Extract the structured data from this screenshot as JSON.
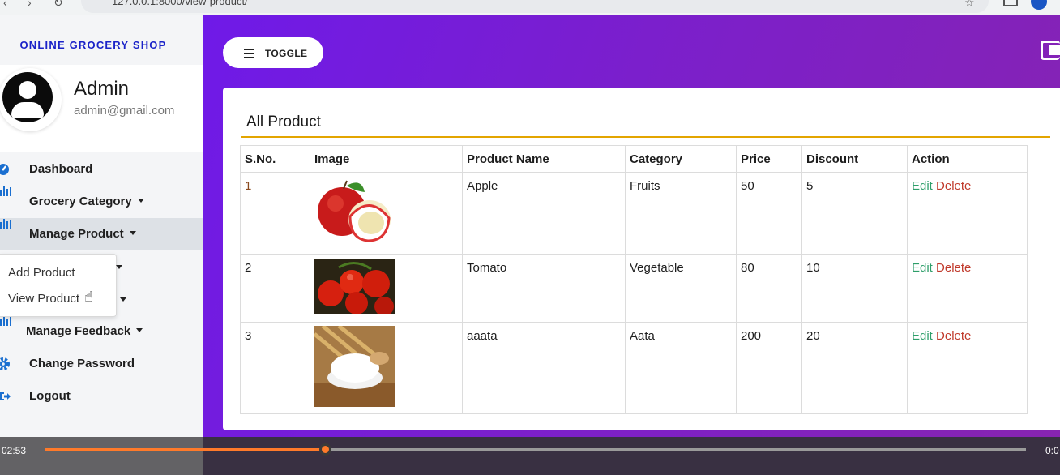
{
  "browser": {
    "url": "127.0.0.1:8000/view-product/"
  },
  "sidebar": {
    "brand": "ONLINE GROCERY SHOP",
    "admin_name": "Admin",
    "admin_email": "admin@gmail.com",
    "menu": [
      {
        "label": "Dashboard",
        "icon": "dashboard-icon"
      },
      {
        "label": "Grocery Category",
        "icon": "bar-chart-icon",
        "has_caret": true
      },
      {
        "label": "Manage Product",
        "icon": "bar-chart-icon",
        "has_caret": true,
        "active": true
      },
      {
        "label": "Manage Feedback",
        "icon": "bar-chart-icon",
        "has_caret": true
      },
      {
        "label": "Change Password",
        "icon": "gear-icon"
      },
      {
        "label": "Logout",
        "icon": "logout-icon"
      }
    ],
    "dropdown": [
      "Add Product",
      "View Product"
    ]
  },
  "header": {
    "toggle_label": "TOGGLE"
  },
  "main": {
    "title": "All Product",
    "columns": [
      "S.No.",
      "Image",
      "Product Name",
      "Category",
      "Price",
      "Discount",
      "Action"
    ],
    "rows": [
      {
        "sno": "1",
        "image": "apple-image",
        "name": "Apple",
        "category": "Fruits",
        "price": "50",
        "discount": "5",
        "edit": "Edit",
        "delete": "Delete"
      },
      {
        "sno": "2",
        "image": "tomato-image",
        "name": "Tomato",
        "category": "Vegetable",
        "price": "80",
        "discount": "10",
        "edit": "Edit",
        "delete": "Delete"
      },
      {
        "sno": "3",
        "image": "flour-image",
        "name": "aaata",
        "category": "Aata",
        "price": "200",
        "discount": "20",
        "edit": "Edit",
        "delete": "Delete"
      }
    ]
  },
  "video": {
    "current_time": "02:53",
    "end_time": "0:0",
    "progress": 0.287
  },
  "colors": {
    "accent_rule": "#e3a500",
    "brand": "#1a22c8",
    "purple": "#7b1fcc"
  }
}
